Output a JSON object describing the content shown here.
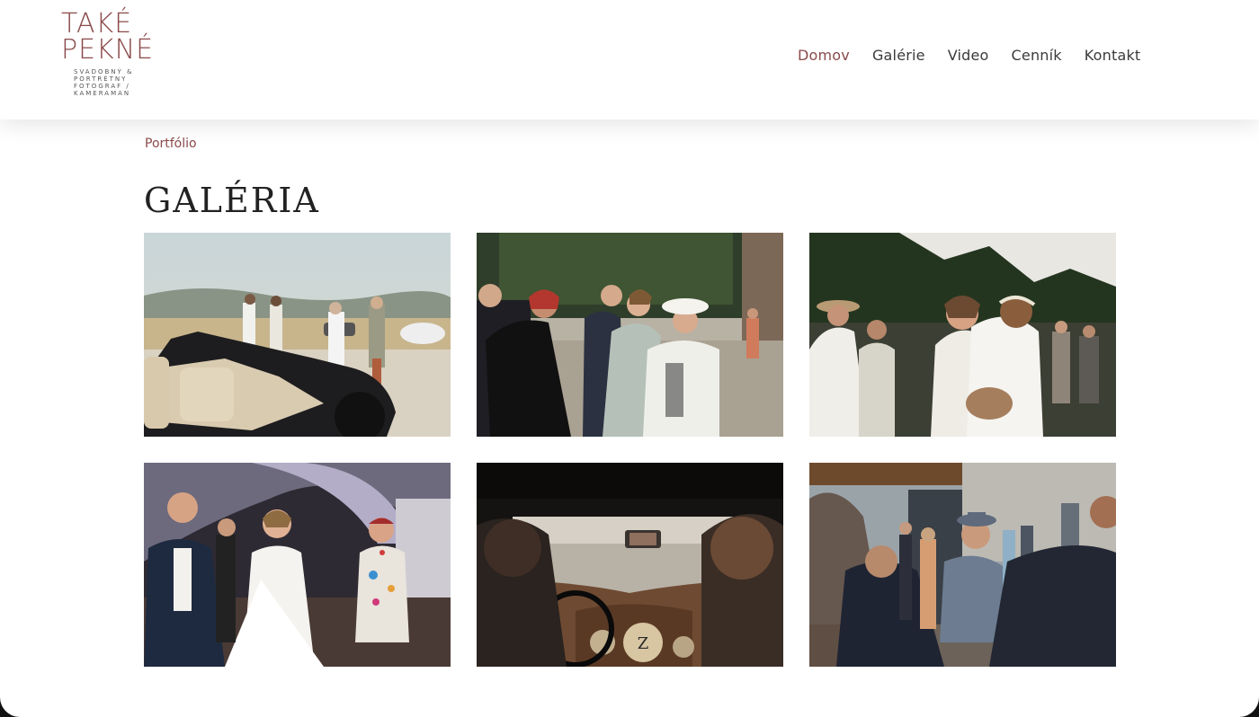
{
  "brand": {
    "logo_line1": "TAKÉ",
    "logo_line2": "PEKNÉ",
    "logo_sub": "SVADOBNÝ & PORTRÉTNY FOTOGRAF / KAMERAMAN",
    "color": "#8a4a4a"
  },
  "nav": {
    "items": [
      {
        "label": "Domov",
        "active": true
      },
      {
        "label": "Galérie",
        "active": false
      },
      {
        "label": "Video",
        "active": false
      },
      {
        "label": "Cenník",
        "active": false
      },
      {
        "label": "Kontakt",
        "active": false
      }
    ]
  },
  "main": {
    "subtitle": "Portfólio",
    "title": "GALÉRIA"
  },
  "gallery": {
    "photos": [
      {
        "icon": "photo-vintage-convertible-guests"
      },
      {
        "icon": "photo-wedding-guests-women"
      },
      {
        "icon": "photo-bride-hugging-guest"
      },
      {
        "icon": "photo-couple-dancing"
      },
      {
        "icon": "photo-car-interior-dashboard"
      },
      {
        "icon": "photo-guests-outside-building"
      }
    ]
  }
}
